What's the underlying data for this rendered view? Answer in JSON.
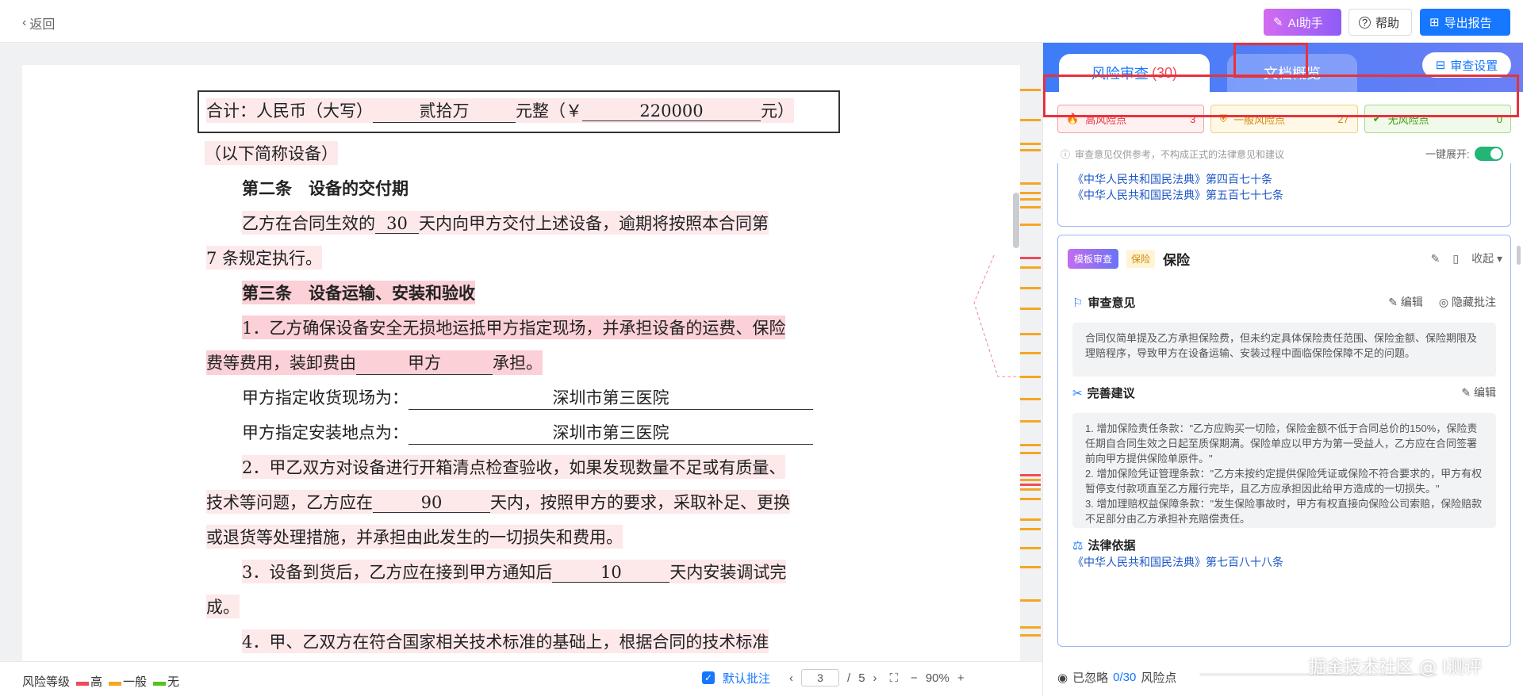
{
  "topbar": {
    "back_label": "返回",
    "ai_label": "AI助手",
    "help_label": "帮助",
    "export_label": "导出报告"
  },
  "doc": {
    "total_prefix": "合计：人民币（大写）",
    "total_upper": "贰拾万",
    "total_mid": "元整（￥",
    "total_number": "220000",
    "total_suffix": "元）",
    "equip_note": "（以下简称设备）",
    "art2_title": "第二条　设备的交付期",
    "art2_p1a": "乙方在合同生效的",
    "art2_days": "30",
    "art2_p1b": "天内向甲方交付上述设备，逾期将按照本合同第",
    "art2_p2": "7 条规定执行。",
    "art3_title": "第三条　设备运输、安装和验收",
    "art3_1a": "1．乙方确保设备安全无损地运抵甲方指定现场，并承担设备的运费、保险",
    "art3_1b": "费等费用，装卸费由",
    "art3_party": "甲方",
    "art3_1c": "承担。",
    "site_label": "甲方指定收货现场为：",
    "site_value": "深圳市第三医院",
    "install_label": "甲方指定安装地点为：",
    "install_value": "深圳市第三医院",
    "art3_2a": "2．甲乙双方对设备进行开箱清点检查验收，如果发现数量不足或有质量、",
    "art3_2b": "技术等问题，乙方应在",
    "art3_2_days": "90",
    "art3_2c": "天内，按照甲方的要求，采取补足、更换",
    "art3_2d": "或退货等处理措施，并承担由此发生的一切损失和费用。",
    "art3_3a": "3．设备到货后，乙方应在接到甲方通知后",
    "art3_3_days": "10",
    "art3_3b": "天内安装调试完",
    "art3_3c": "成。",
    "art3_4a": "4．甲、乙双方在符合国家相关技术标准的基础上，根据合同的技术标准"
  },
  "bottom": {
    "legend_label": "风险等级",
    "legend_high": "高",
    "legend_mid": "一般",
    "legend_none": "无",
    "default_note": "默认批注",
    "page_current": "3",
    "page_sep": "/",
    "page_total": "5",
    "zoom": "90%"
  },
  "panel": {
    "tab_risk": "风险审查",
    "tab_risk_count": "(30)",
    "tab_overview": "文档概览",
    "review_settings": "审查设置",
    "high_label": "高风险点",
    "high_count": "3",
    "mid_label": "一般风险点",
    "mid_count": "27",
    "none_label": "无风险点",
    "none_count": "0",
    "notice": "审查意见仅供参考，不构成正式的法律意见和建议",
    "expand_all": "一键展开:",
    "prev_law_1": "《中华人民共和国民法典》第四百七十条",
    "prev_law_2": "《中华人民共和国民法典》第五百七十七条",
    "card": {
      "tag_template": "模板审查",
      "tag_type": "保险",
      "title": "保险",
      "collapse": "收起",
      "opinion_title": "审查意见",
      "edit": "编辑",
      "hide_note": "隐藏批注",
      "opinion_text": "合同仅简单提及乙方承担保险费，但未约定具体保险责任范围、保险金额、保险期限及理赔程序，导致甲方在设备运输、安装过程中面临保险保障不足的问题。",
      "suggest_title": "完善建议",
      "suggest_edit": "编辑",
      "suggest_1": "1. 增加保险责任条款：\"乙方应购买一切险，保险金额不低于合同总价的150%，保险责任期自合同生效之日起至质保期满。保险单应以甲方为第一受益人，乙方应在合同签署前向甲方提供保险单原件。\"",
      "suggest_2": "2. 增加保险凭证管理条款：\"乙方未按约定提供保险凭证或保险不符合要求的，甲方有权暂停支付款项直至乙方履行完毕，且乙方应承担因此给甲方造成的一切损失。\"",
      "suggest_3": "3. 增加理赔权益保障条款：\"发生保险事故时，甲方有权直接向保险公司索赔，保险赔款不足部分由乙方承担补充赔偿责任。",
      "law_title": "法律依据",
      "law_link": "《中华人民共和国民法典》第七百八十八条"
    },
    "ignored_prefix": "已忽略",
    "ignored_count": "0/30",
    "ignored_suffix": "风险点"
  },
  "watermark": "掘金技术社区 @ I测评",
  "colors": {
    "accent": "#1677ff",
    "high": "#f04a5a",
    "mid": "#f5a623",
    "none": "#52c41a"
  }
}
